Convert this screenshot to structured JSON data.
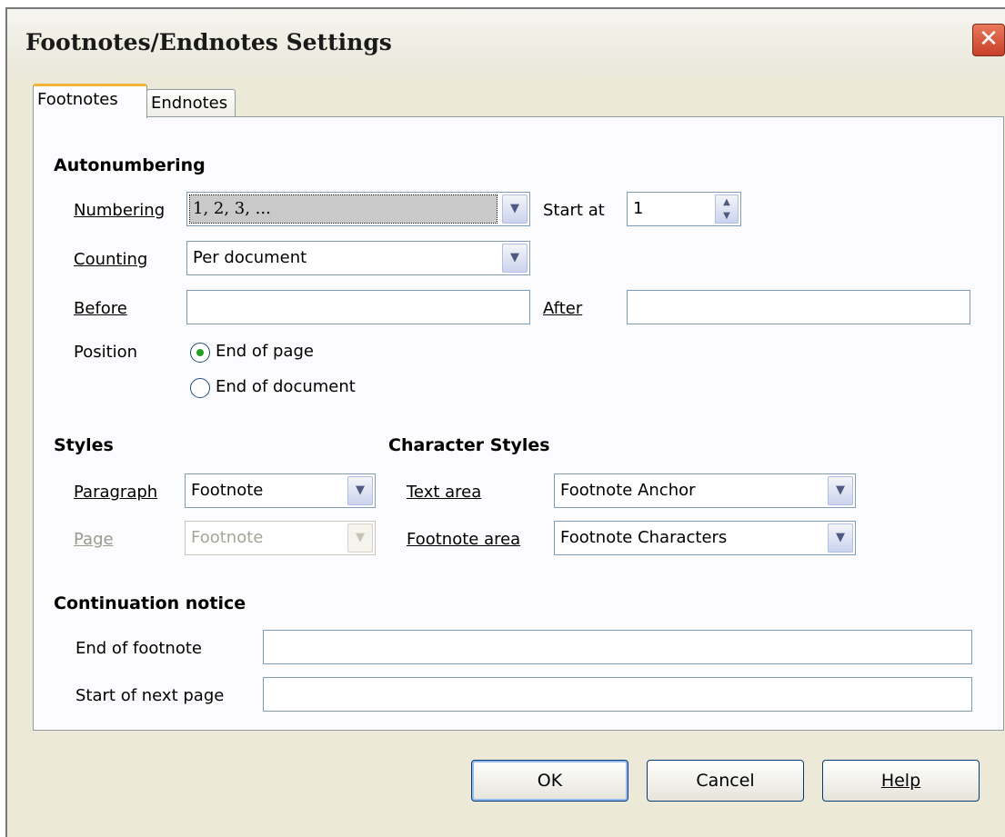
{
  "window": {
    "title": "Footnotes/Endnotes Settings",
    "close_glyph": "✕"
  },
  "tabs": {
    "footnotes": "Footnotes",
    "endnotes": "Endnotes"
  },
  "autonumbering": {
    "heading": "Autonumbering",
    "numbering_label": "Numbering",
    "numbering_value": "1, 2, 3, ...",
    "start_at_label": "Start at",
    "start_at_value": "1",
    "counting_label": "Counting",
    "counting_value": "Per document",
    "before_label": "Before",
    "before_value": "",
    "after_label": "After",
    "after_value": "",
    "position_label": "Position",
    "position_options": [
      "End of page",
      "End of document"
    ],
    "position_selected": "End of page"
  },
  "styles": {
    "heading": "Styles",
    "paragraph_label": "Paragraph",
    "paragraph_value": "Footnote",
    "page_label": "Page",
    "page_value": "Footnote"
  },
  "character_styles": {
    "heading": "Character Styles",
    "text_area_label": "Text area",
    "text_area_value": "Footnote Anchor",
    "footnote_area_label": "Footnote area",
    "footnote_area_value": "Footnote Characters"
  },
  "continuation": {
    "heading": "Continuation notice",
    "end_label": "End of footnote",
    "end_value": "",
    "start_label": "Start of next page",
    "start_value": ""
  },
  "buttons": {
    "ok": "OK",
    "cancel": "Cancel",
    "help": "Help"
  },
  "colors": {
    "dialog_bg": "#ece9d8",
    "panel_bg": "#fcfcfe",
    "close_button": "#c8402a",
    "radio_selected": "#21a121",
    "field_border": "#7f9db9"
  }
}
